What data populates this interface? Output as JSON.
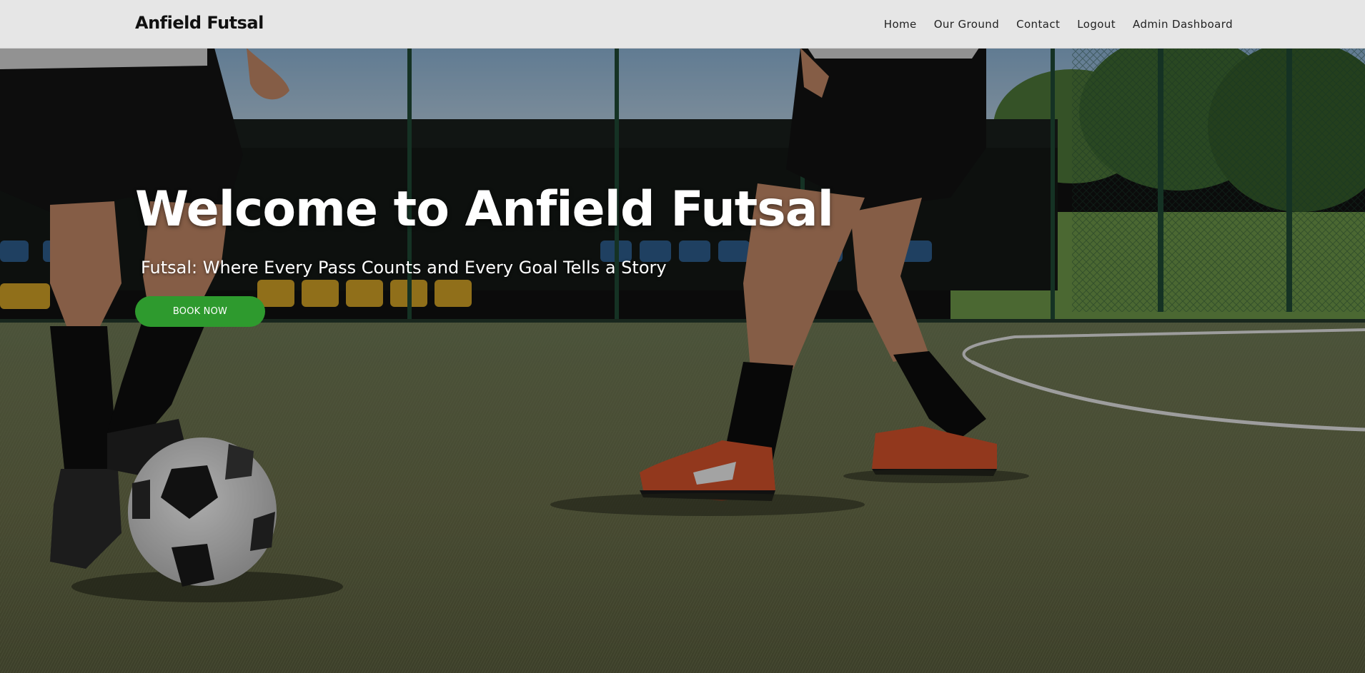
{
  "brand": {
    "name": "Anfield Futsal"
  },
  "nav": {
    "items": [
      {
        "label": "Home"
      },
      {
        "label": "Our Ground"
      },
      {
        "label": "Contact"
      },
      {
        "label": "Logout"
      },
      {
        "label": "Admin Dashboard"
      }
    ]
  },
  "hero": {
    "title": "Welcome to Anfield Futsal",
    "subtitle": "Futsal: Where Every Pass Counts and Every Goal Tells a Story",
    "cta_label": "BOOK NOW"
  },
  "colors": {
    "nav_bg": "#e6e6e6",
    "cta_bg": "#2e9a2e",
    "text_light": "#ffffff"
  }
}
